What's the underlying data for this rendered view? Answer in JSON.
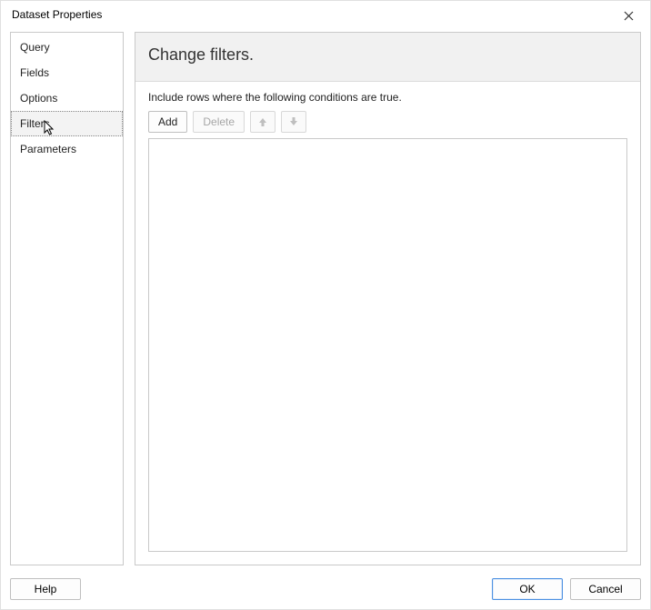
{
  "dialog": {
    "title": "Dataset Properties"
  },
  "sidebar": {
    "items": [
      {
        "label": "Query"
      },
      {
        "label": "Fields"
      },
      {
        "label": "Options"
      },
      {
        "label": "Filters"
      },
      {
        "label": "Parameters"
      }
    ],
    "selected_index": 3
  },
  "main": {
    "heading": "Change filters.",
    "description": "Include rows where the following conditions are true.",
    "toolbar": {
      "add_label": "Add",
      "delete_label": "Delete"
    }
  },
  "footer": {
    "help_label": "Help",
    "ok_label": "OK",
    "cancel_label": "Cancel"
  }
}
